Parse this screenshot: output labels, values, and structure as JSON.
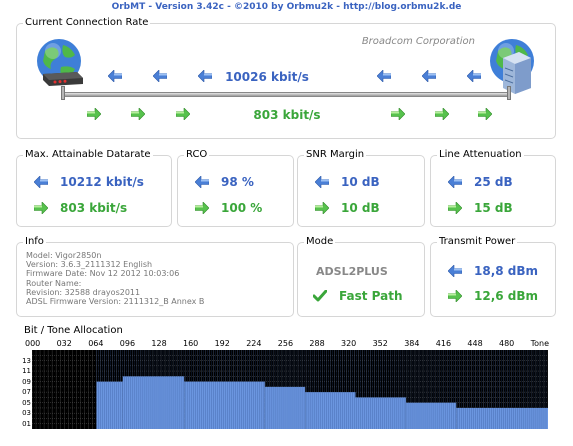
{
  "window": {
    "title": "OrbMT - Version 3.42c - ©2010 by Orbmu2k - http://blog.orbmu2k.de"
  },
  "connection": {
    "group_title": "Current Connection Rate",
    "chipset": "Broadcom Corporation",
    "downstream": "10026 kbit/s",
    "upstream": "803 kbit/s"
  },
  "max_rate": {
    "title": "Max. Attainable Datarate",
    "down": "10212 kbit/s",
    "up": "803 kbit/s"
  },
  "rco": {
    "title": "RCO",
    "down": "98 %",
    "up": "100 %"
  },
  "snr": {
    "title": "SNR Margin",
    "down": "10 dB",
    "up": "10 dB"
  },
  "attenuation": {
    "title": "Line Attenuation",
    "down": "25 dB",
    "up": "15 dB"
  },
  "info": {
    "title": "Info",
    "lines": [
      "Model: Vigor2850n",
      "Version: 3.6.3_2111312 English",
      "Firmware Date: Nov 12 2012 10:03:06",
      "Router Name:",
      "Revision: 32588 drayos2011",
      "ADSL Firmware Version: 2111312_B   Annex B"
    ]
  },
  "mode": {
    "title": "Mode",
    "standard": "ADSL2PLUS",
    "path": "Fast Path"
  },
  "transmit_power": {
    "title": "Transmit Power",
    "down": "18,8 dBm",
    "up": "12,6 dBm"
  },
  "tones": {
    "title": "Bit / Tone Allocation",
    "x_labels": [
      "000",
      "032",
      "064",
      "096",
      "128",
      "160",
      "192",
      "224",
      "256",
      "288",
      "320",
      "352",
      "384",
      "416",
      "448",
      "480",
      "Tone"
    ],
    "y_labels": [
      "13",
      "11",
      "09",
      "07",
      "05",
      "03",
      "01"
    ]
  },
  "chart_data": {
    "type": "bar",
    "title": "Bit / Tone Allocation",
    "xlabel": "Tone",
    "ylabel": "",
    "xlim": [
      0,
      511
    ],
    "ylim": [
      0,
      15
    ],
    "bands": [
      {
        "tone_start": 0,
        "tone_end": 63,
        "bits": 0
      },
      {
        "tone_start": 64,
        "tone_end": 89,
        "bits": 9
      },
      {
        "tone_start": 90,
        "tone_end": 150,
        "bits": 10
      },
      {
        "tone_start": 151,
        "tone_end": 230,
        "bits": 9
      },
      {
        "tone_start": 231,
        "tone_end": 270,
        "bits": 8
      },
      {
        "tone_start": 271,
        "tone_end": 320,
        "bits": 7
      },
      {
        "tone_start": 321,
        "tone_end": 370,
        "bits": 6
      },
      {
        "tone_start": 371,
        "tone_end": 420,
        "bits": 5
      },
      {
        "tone_start": 421,
        "tone_end": 511,
        "bits": 4
      }
    ],
    "colors": {
      "bars": "#6b96e0",
      "background": "#000000",
      "grid": "#555555"
    }
  },
  "colors": {
    "accent_blue": "#3a63c0",
    "accent_green": "#3aa63a",
    "border": "#d6d6d6"
  }
}
